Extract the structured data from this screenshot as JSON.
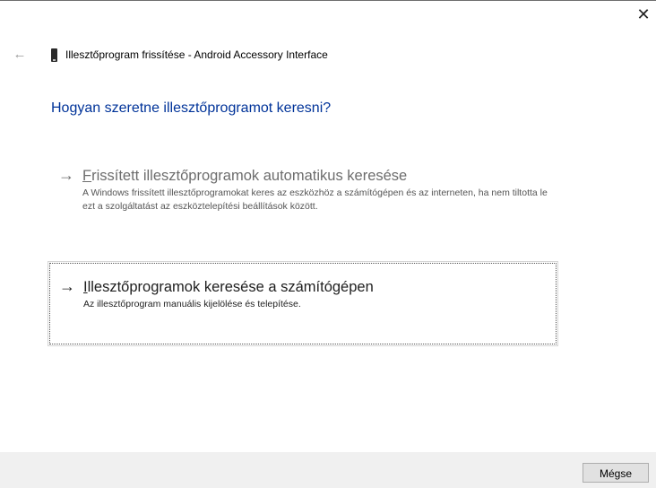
{
  "window": {
    "close_glyph": "✕",
    "back_glyph": "←",
    "title": "Illesztőprogram frissítése - Android Accessory Interface"
  },
  "heading": "Hogyan szeretne illesztőprogramot keresni?",
  "options": [
    {
      "arrow": "→",
      "label_access_letter": "F",
      "label_rest": "rissített illesztőprogramok automatikus keresése",
      "description": "A Windows frissített illesztőprogramokat keres az eszközhöz a számítógépen és az interneten, ha nem tiltotta le ezt a szolgáltatást az eszköztelepítési beállítások között.",
      "disabled": true
    },
    {
      "arrow": "→",
      "label_access_letter": "I",
      "label_rest": "llesztőprogramok keresése a számítógépen",
      "description": "Az illesztőprogram manuális kijelölése és telepítése.",
      "focused": true
    }
  ],
  "footer": {
    "cancel_label": "Mégse"
  },
  "icons": {
    "device": "phone-device-icon",
    "back": "back-arrow-icon",
    "close": "close-icon"
  },
  "colors": {
    "heading": "#003399",
    "footer_bg": "#f0f0f0",
    "disabled_text": "#6d6d6d"
  }
}
